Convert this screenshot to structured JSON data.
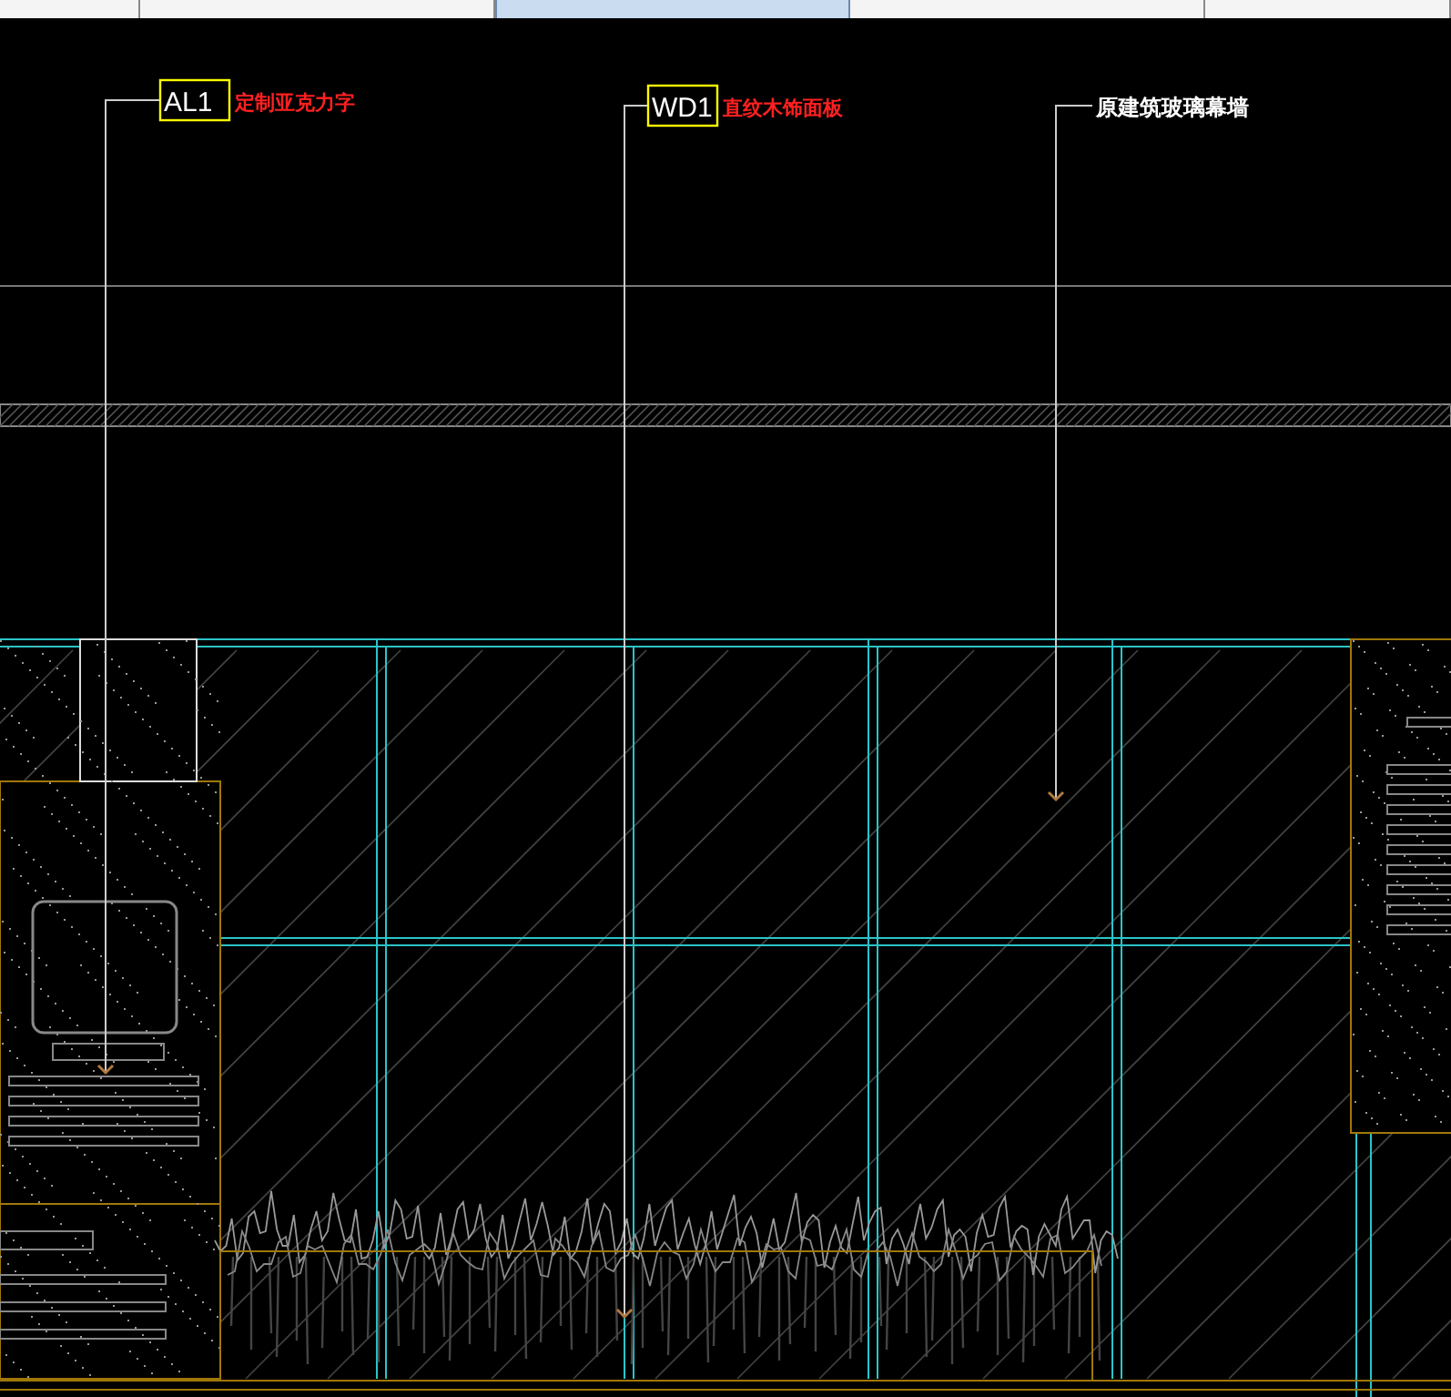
{
  "tabs": [
    {
      "selected": false
    },
    {
      "selected": false
    },
    {
      "selected": true
    },
    {
      "selected": false
    },
    {
      "selected": false
    }
  ],
  "annotations": [
    {
      "kind": "tagged",
      "tag": "AL1",
      "text": "定制亚克力字"
    },
    {
      "kind": "tagged",
      "tag": "WD1",
      "text": "直纹木饰面板"
    },
    {
      "kind": "plain",
      "text": "原建筑玻璃幕墙"
    }
  ]
}
